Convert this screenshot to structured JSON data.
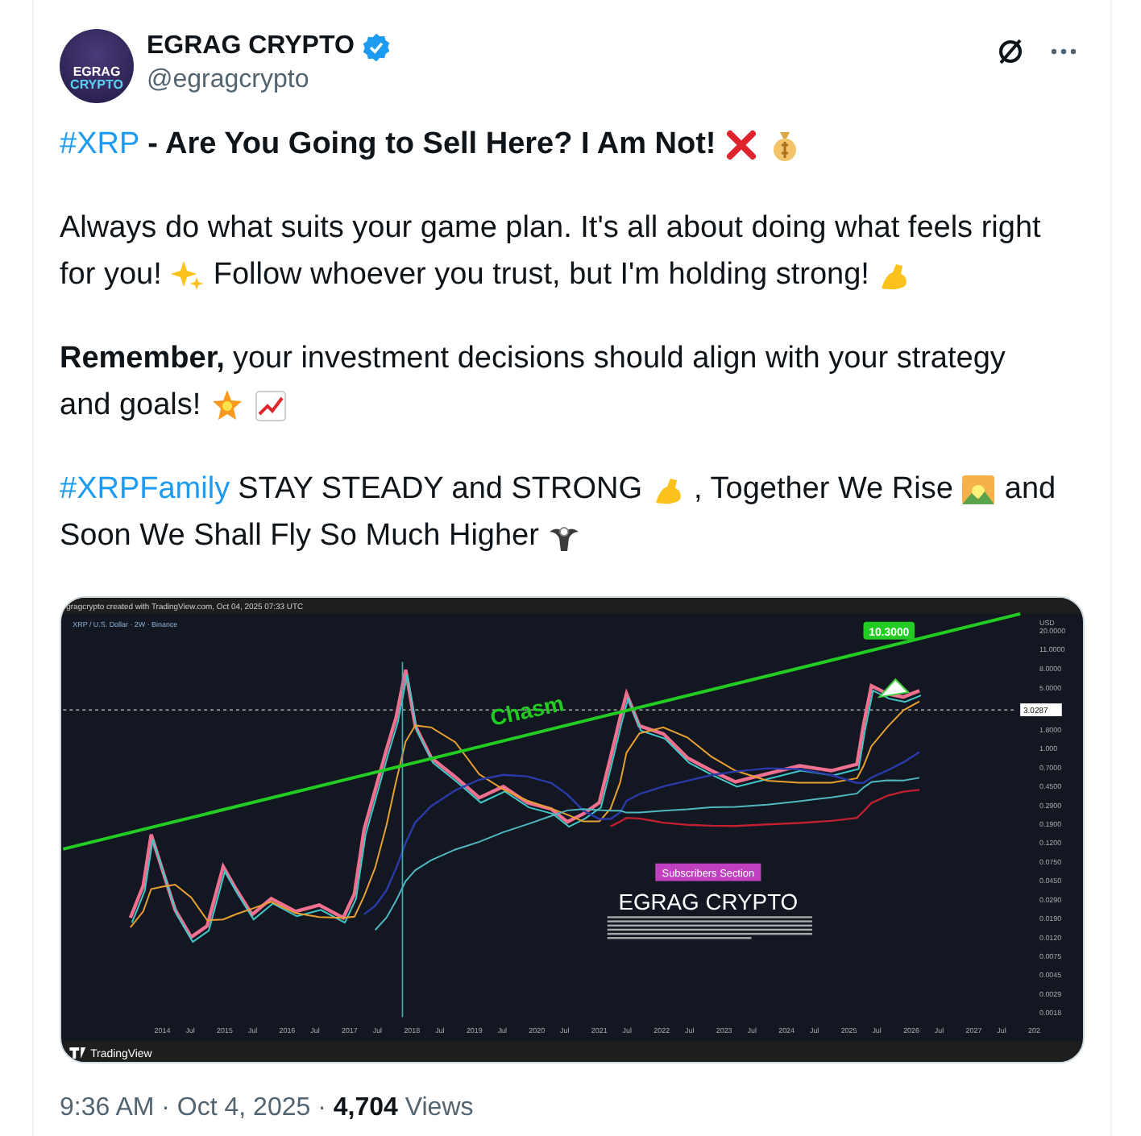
{
  "author": {
    "avatar_text": [
      "EGRAG",
      "CRYPTO"
    ],
    "display_name": "EGRAG CRYPTO",
    "verified": true,
    "handle": "@egragcrypto"
  },
  "paragraphs": [
    [
      [
        {
          "kind": "hashtag",
          "text": "#XRP"
        },
        {
          "kind": "bold",
          "text": "- Are You Going to Sell Here? I Am Not!"
        },
        {
          "kind": "emoji"
        },
        {
          "kind": "emoji"
        }
      ]
    ],
    [
      [
        {
          "kind": "text",
          "text": "Always do what suits your game plan. It's all about doing what feels right"
        }
      ],
      [
        {
          "kind": "text",
          "text": "for you!"
        },
        {
          "kind": "emoji"
        },
        {
          "kind": "text",
          "text": "Follow whoever you trust, but I'm holding strong!"
        },
        {
          "kind": "emoji"
        }
      ]
    ],
    [
      [
        {
          "kind": "bold",
          "text": "Remember,"
        },
        {
          "kind": "text",
          "text": "your investment decisions should align with your strategy"
        }
      ],
      [
        {
          "kind": "text",
          "text": "and goals!"
        },
        {
          "kind": "emoji"
        },
        {
          "kind": "emoji"
        }
      ]
    ],
    [
      [
        {
          "kind": "hashtag",
          "text": "#XRPFamily"
        },
        {
          "kind": "text",
          "text": "STAY STEADY and STRONG"
        },
        {
          "kind": "emoji"
        },
        {
          "kind": "text",
          "text": ", Together We Rise"
        },
        {
          "kind": "emoji"
        },
        {
          "kind": "text",
          "text": "and"
        }
      ],
      [
        {
          "kind": "text",
          "text": "Soon We Shall Fly So Much Higher"
        },
        {
          "kind": "emoji"
        }
      ]
    ]
  ],
  "chart_image": {
    "header": "gragcrypto created with TradingView.com, Oct 04, 2025 07:33 UTC",
    "legend": "XRP / U.S. Dollar · 2W · Binance",
    "target_label": "10.3000",
    "trendline_label": "Chasm",
    "price_tag": "3.0287",
    "badge": "Subscribers Section",
    "watermark": "EGRAG CRYPTO",
    "footer_brand": "TradingView",
    "y_labels": [
      "USD",
      "20.0000",
      "11.0000",
      "8.0000",
      "5.0000",
      "1.8000",
      "1.000",
      "0.7000",
      "0.4500",
      "0.2900",
      "0.1900",
      "0.1200",
      "0.0750",
      "0.0450",
      "0.0290",
      "0.0190",
      "0.0120",
      "0.0075",
      "0.0045",
      "0.0029",
      "0.0018"
    ],
    "x_labels": [
      "2014",
      "Jul",
      "2015",
      "Jul",
      "2016",
      "Jul",
      "2017",
      "Jul",
      "2018",
      "Jul",
      "2019",
      "Jul",
      "2020",
      "Jul",
      "2021",
      "Jul",
      "2022",
      "Jul",
      "2023",
      "Jul",
      "2024",
      "Jul",
      "2025",
      "Jul",
      "2026",
      "Jul",
      "2027",
      "Jul",
      "202"
    ]
  },
  "meta": "9:36 AM · Oct 4, 2025 · **4,704** Views"
}
